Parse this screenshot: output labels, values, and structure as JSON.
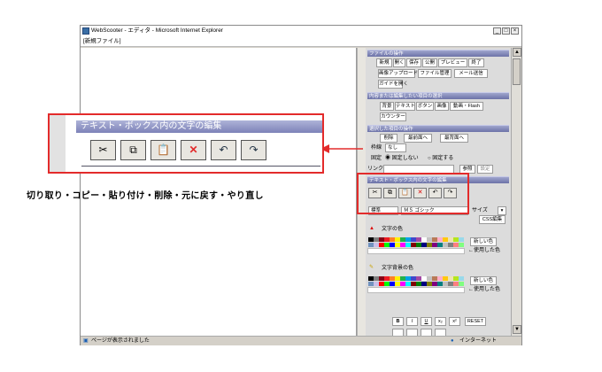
{
  "window": {
    "title": "WebScooter - エディタ - Microsoft Internet Explorer",
    "min": "_",
    "max": "□",
    "close": "×",
    "address": "[新規ファイル]"
  },
  "sections": {
    "file": "ファイルの操作",
    "add": "内容または編集したい項目の選択",
    "selected": "選択した項目の操作",
    "textbox": "テキスト・ボックス内の文字の編集"
  },
  "file_buttons": [
    "新規",
    "開く",
    "保存",
    "公開",
    "プレビュー",
    "終了"
  ],
  "file_buttons2": [
    "画像アップロード",
    "ファイル管理",
    "メール送信"
  ],
  "guide_button": "ガイドを開く",
  "add_buttons": [
    "背景",
    "テキスト",
    "ボタン",
    "画像",
    "動画・Flash"
  ],
  "counter_button": "カウンター",
  "op_buttons": [
    "削除",
    "最前面へ",
    "最背面へ"
  ],
  "frame_label": "枠線",
  "frame_value": "なし",
  "fix_label": "固定",
  "fix_opt1": "固定しない",
  "fix_opt2": "固定する",
  "link_label": "リンク",
  "ref_button": "参照",
  "set_button": "設定",
  "edit_icons": [
    "✂",
    "⧉",
    "📋",
    "✕",
    "↶",
    "↷"
  ],
  "font_size_value": "標準",
  "font_name_value": "ＭＳ ゴシック",
  "size_label": "サイズ",
  "css_button": "CSS編集",
  "text_color_label": "文字の色",
  "bg_color_label": "文字背景の色",
  "new_color_button": "新しい色",
  "used_label": "←使用した色",
  "format_buttons": [
    "B",
    "I",
    "U",
    "x₂",
    "x²"
  ],
  "reset_button": "RESET",
  "palette_row1": [
    "#000000",
    "#7f7f7f",
    "#880015",
    "#ed1c24",
    "#ff7f27",
    "#fff200",
    "#22b14c",
    "#00a2e8",
    "#3f48cc",
    "#a349a4",
    "#ffffff",
    "#c3c3c3",
    "#b97a57",
    "#ffaec9",
    "#ffc90e",
    "#efe4b0",
    "#b5e61d",
    "#99d9ea"
  ],
  "palette_row2": [
    "#7092be",
    "#c8bfe7",
    "#ff0000",
    "#00ff00",
    "#0000ff",
    "#ffff00",
    "#ff00ff",
    "#00ffff",
    "#800000",
    "#008000",
    "#000080",
    "#808000",
    "#800080",
    "#008080",
    "#c0c0c0",
    "#808080",
    "#ff8080",
    "#80ff80"
  ],
  "palette_used": [
    "#ffffff",
    "#ffffff",
    "#ffffff",
    "#ffffff",
    "#ffffff",
    "#ffffff",
    "#ffffff",
    "#ffffff",
    "#ffffff",
    "#ffffff",
    "#ffffff",
    "#ffffff",
    "#ffffff",
    "#ffffff",
    "#ffffff",
    "#ffffff",
    "#ffffff",
    "#ffffff"
  ],
  "status": {
    "text": "ページが表示されました",
    "zone": "インターネット"
  },
  "zoom": {
    "header": "テキスト・ボックス内の文字の編集",
    "icons": [
      "✂",
      "⧉",
      "📋",
      "✕",
      "↶",
      "↷"
    ]
  },
  "caption": "切り取り・コピー・貼り付け・削除・元に戻す・やり直し",
  "colors": {
    "accent": "#e32b2b",
    "section": "#7d82b8"
  }
}
